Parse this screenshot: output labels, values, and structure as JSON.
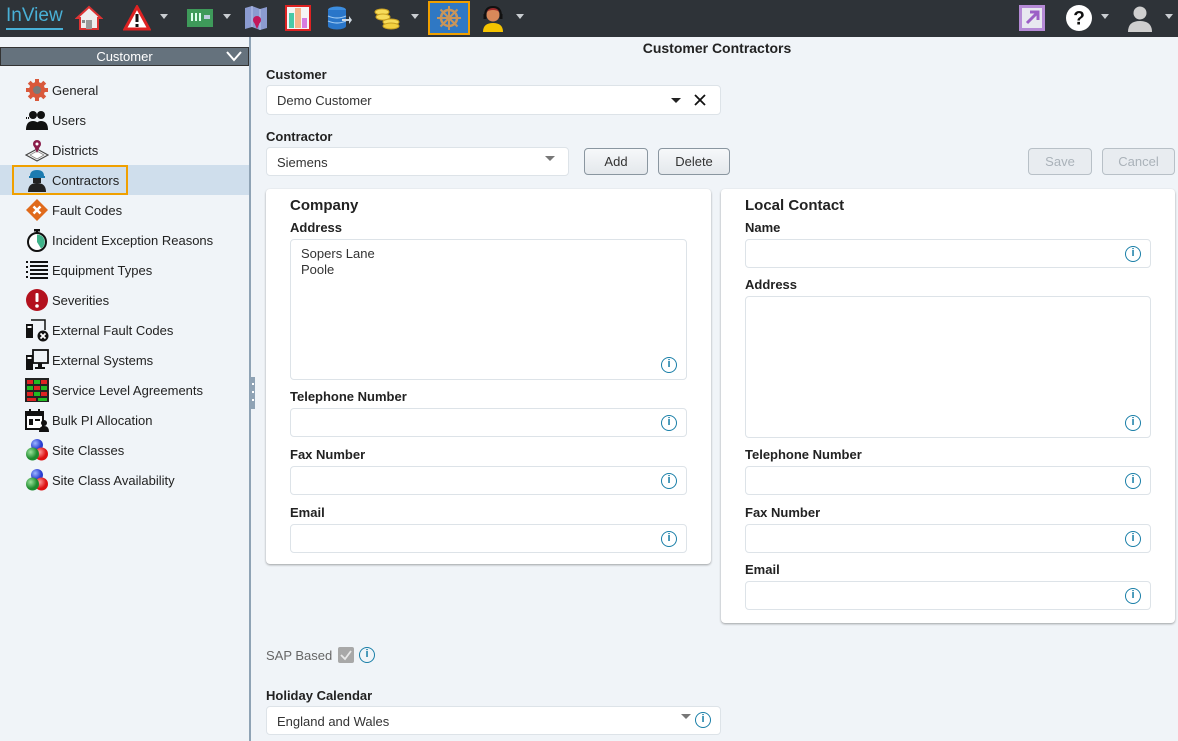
{
  "app": {
    "brand": "InView",
    "toolbar": [
      {
        "name": "home-icon",
        "dropdown": false
      },
      {
        "name": "alarm-warning-icon",
        "dropdown": true
      },
      {
        "name": "hardware-board-icon",
        "dropdown": true
      },
      {
        "name": "map-icon",
        "dropdown": false
      },
      {
        "name": "reports-chart-icon",
        "dropdown": false
      },
      {
        "name": "database-export-icon",
        "dropdown": false
      },
      {
        "name": "coins-icon",
        "dropdown": true
      },
      {
        "name": "ship-wheel-icon",
        "dropdown": false,
        "active": true
      },
      {
        "name": "operator-headset-icon",
        "dropdown": true
      }
    ],
    "right_toolbar": [
      {
        "name": "popout-icon",
        "dropdown": false
      },
      {
        "name": "help-icon",
        "dropdown": true
      },
      {
        "name": "user-icon",
        "dropdown": true
      }
    ],
    "accent": "#f0a000"
  },
  "sidebar": {
    "header": "Customer",
    "items": [
      {
        "label": "General",
        "icon": "gear-icon"
      },
      {
        "label": "Users",
        "icon": "users-icon"
      },
      {
        "label": "Districts",
        "icon": "district-pin-icon"
      },
      {
        "label": "Contractors",
        "icon": "contractor-icon",
        "selected": true
      },
      {
        "label": "Fault Codes",
        "icon": "fault-code-icon"
      },
      {
        "label": "Incident Exception Reasons",
        "icon": "stopwatch-icon"
      },
      {
        "label": "Equipment Types",
        "icon": "list-icon"
      },
      {
        "label": "Severities",
        "icon": "severity-exclamation-icon"
      },
      {
        "label": "External Fault Codes",
        "icon": "external-fault-codes-icon"
      },
      {
        "label": "External Systems",
        "icon": "external-systems-icon"
      },
      {
        "label": "Service Level Agreements",
        "icon": "sla-grid-icon"
      },
      {
        "label": "Bulk PI Allocation",
        "icon": "bulk-allocation-icon"
      },
      {
        "label": "Site Classes",
        "icon": "site-classes-balls-icon"
      },
      {
        "label": "Site Class Availability",
        "icon": "site-class-availability-icon"
      }
    ]
  },
  "main": {
    "title": "Customer Contractors",
    "customer": {
      "label": "Customer",
      "value": "Demo Customer"
    },
    "contractor": {
      "label": "Contractor",
      "value": "Siemens"
    },
    "buttons": {
      "add": "Add",
      "delete": "Delete",
      "save": "Save",
      "cancel": "Cancel"
    },
    "company": {
      "heading": "Company",
      "address_label": "Address",
      "address_lines": [
        "Sopers Lane",
        "Poole"
      ],
      "telephone_label": "Telephone Number",
      "telephone": "",
      "fax_label": "Fax Number",
      "fax": "",
      "email_label": "Email",
      "email": ""
    },
    "local_contact": {
      "heading": "Local Contact",
      "name_label": "Name",
      "name": "",
      "address_label": "Address",
      "address": "",
      "telephone_label": "Telephone Number",
      "telephone": "",
      "fax_label": "Fax Number",
      "fax": "",
      "email_label": "Email",
      "email": ""
    },
    "sap_based": {
      "label": "SAP Based",
      "checked": true,
      "disabled": true
    },
    "holiday_calendar": {
      "label": "Holiday Calendar",
      "value": "England and Wales"
    },
    "info_glyph": "i"
  }
}
